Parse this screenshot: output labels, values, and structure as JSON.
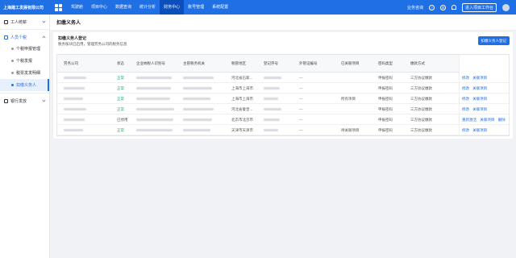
{
  "app": {
    "brand": "上海建工发展有限公司",
    "nav": [
      "驾驶舱",
      "项目中心",
      "数据查询",
      "统计分析",
      "财务中心",
      "账号管理",
      "系统配置"
    ],
    "nav_active_index": 4,
    "service": "业务咨询",
    "enter_workbench": "进入项目工作台",
    "icons": [
      "help-icon",
      "settings-icon",
      "bell-icon"
    ]
  },
  "sidebar": {
    "group_workers": "工人统薪",
    "group_tax": "人员个税",
    "items": [
      "个税申报管理",
      "个税发报",
      "税票发发明细",
      "扣缴义务人"
    ],
    "active_index": 3,
    "group_bank": "银行发放"
  },
  "page": {
    "title": "扣缴义务人"
  },
  "card": {
    "title": "扣缴义务人登记",
    "subtitle": "税务核块已启用，管理劳务公司的税务信息",
    "add_button": "扣缴义务人登记"
  },
  "table": {
    "columns": [
      "劳务公司",
      "状态",
      "企业纳税人识别号",
      "主管税务机关",
      "税管地区",
      "登记序号",
      "外管证编号",
      "已关联项目",
      "密码类型",
      "缴款方式",
      "操作"
    ],
    "rows": [
      {
        "status": "正常",
        "status_kind": "ok",
        "region": "河北省石家...",
        "permit": "---",
        "projects": "",
        "pwd": "申报密码",
        "pay": "三方协议缴款",
        "ops": [
          "修改",
          "关联项目"
        ]
      },
      {
        "status": "正常",
        "status_kind": "ok",
        "region": "上海市上海市",
        "permit": "---",
        "projects": "",
        "pwd": "申报密码",
        "pay": "三方协议缴款",
        "ops": [
          "修改",
          "关联项目"
        ]
      },
      {
        "status": "正常",
        "status_kind": "ok",
        "region": "上海市上海市",
        "permit": "---",
        "projects": "所有项目",
        "pwd": "申报密码",
        "pay": "三方协议缴款",
        "ops": [
          "修改",
          "关联项目"
        ]
      },
      {
        "status": "正常",
        "status_kind": "ok",
        "region": "河北省秦皇...",
        "permit": "---",
        "projects": "",
        "pwd": "申报密码",
        "pay": "三方协议缴款",
        "ops": [
          "修改",
          "关联项目"
        ]
      },
      {
        "status": "已停用",
        "status_kind": "off",
        "region": "北京市北京市",
        "permit": "---",
        "projects": "",
        "pwd": "申报密码",
        "pay": "三方协议缴款",
        "ops": [
          "重新激活",
          "关联项目",
          "删除"
        ]
      },
      {
        "status": "正常",
        "status_kind": "ok",
        "region": "天津市天津市",
        "permit": "---",
        "projects": "待关联项目",
        "pwd": "申报密码",
        "pay": "三方协议缴款",
        "ops": [
          "修改",
          "关联项目"
        ]
      }
    ]
  },
  "colors": {
    "primary": "#1f6fe5",
    "nav_active": "#0b4fbd",
    "status_ok": "#19a974"
  }
}
